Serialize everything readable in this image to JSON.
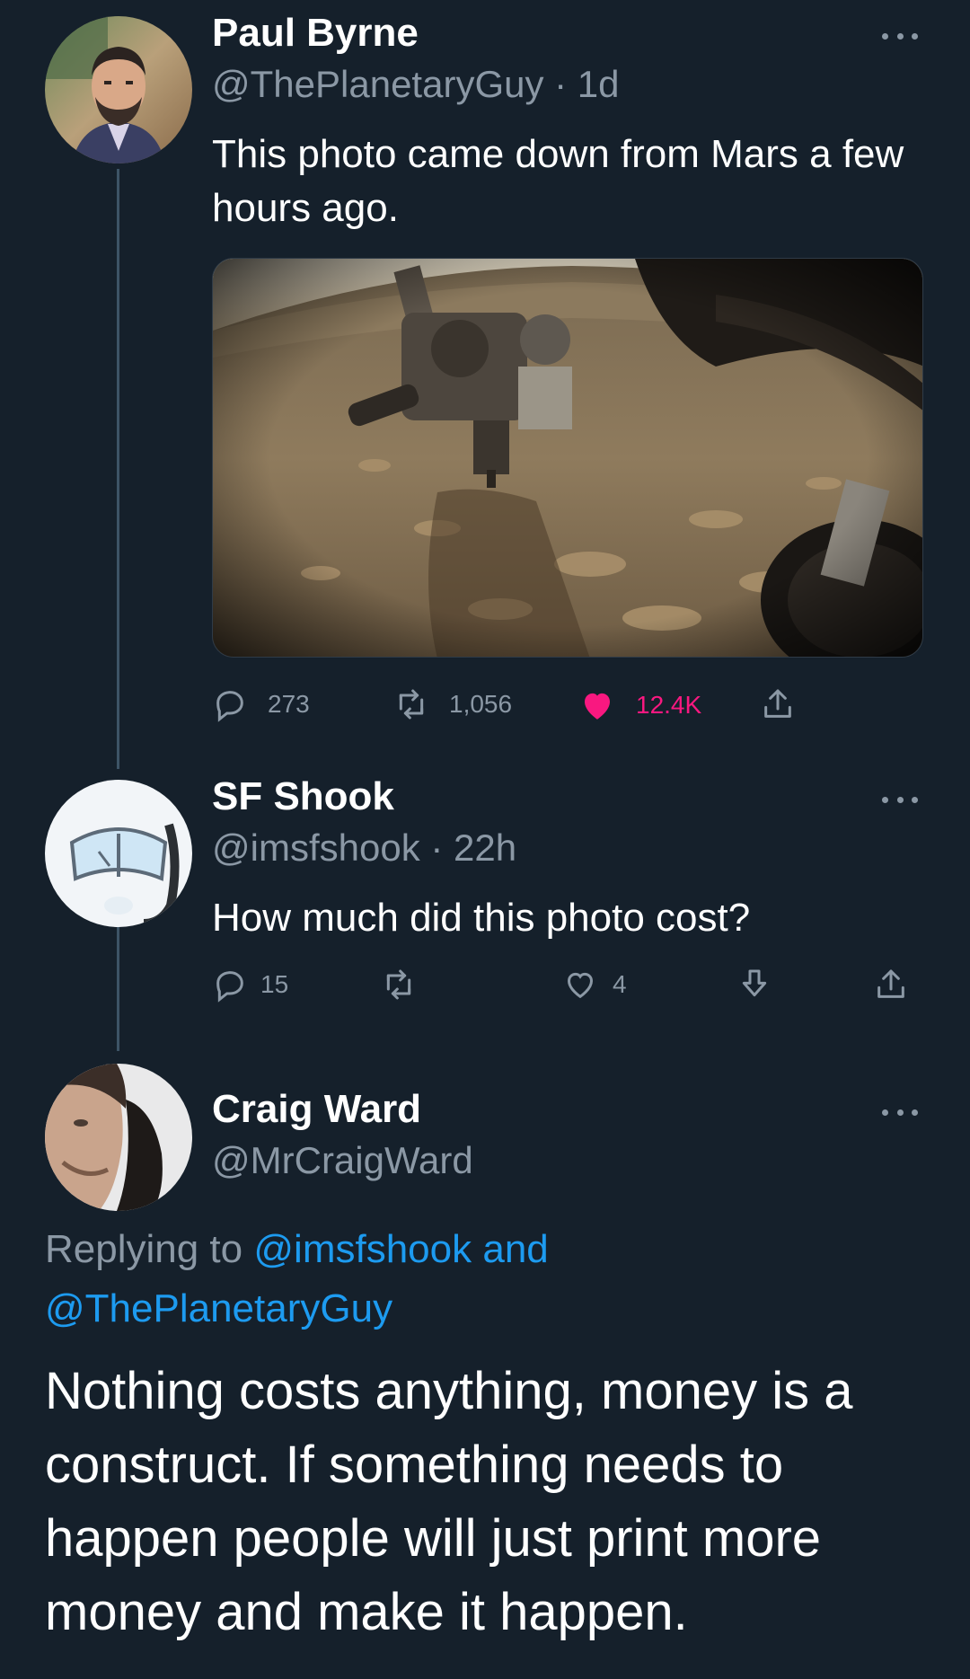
{
  "tweets": [
    {
      "name": "Paul Byrne",
      "handle": "@ThePlanetaryGuy",
      "time": "· 1d",
      "text": "This photo came down from Mars a few hours ago.",
      "media_icon": "mars-rover-photo",
      "actions": {
        "replies": "273",
        "retweets": "1,056",
        "likes": "12.4K",
        "liked": true
      }
    },
    {
      "name": "SF Shook",
      "handle": "@imsfshook",
      "time": "· 22h",
      "text": "How much did this photo cost?",
      "actions": {
        "replies": "15",
        "retweets": "",
        "likes": "4"
      }
    },
    {
      "name": "Craig Ward",
      "handle": "@MrCraigWard",
      "replying_prefix": "Replying to",
      "replying_mention_1": "@imsfshook",
      "replying_and": "and",
      "replying_mention_2": "@ThePlanetaryGuy",
      "text": "Nothing costs anything, money is a  construct. If something needs to happen people will just print more money and make it happen."
    }
  ],
  "colors": {
    "background": "#15202b",
    "secondary_text": "#8b98a5",
    "link": "#1d9bf0",
    "like": "#f91880"
  }
}
